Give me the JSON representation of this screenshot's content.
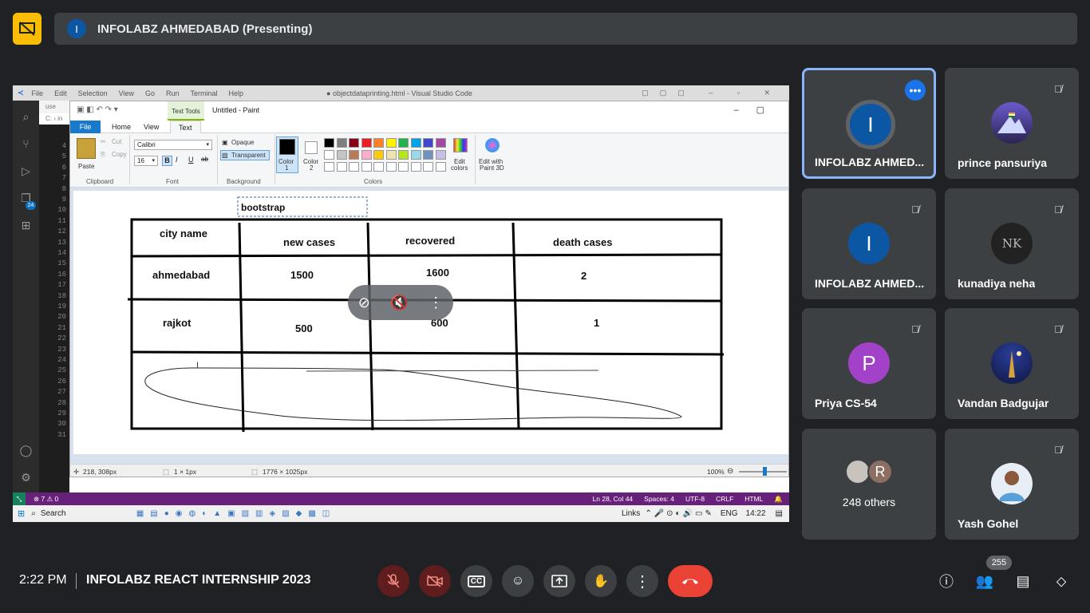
{
  "presenter_bar": {
    "avatar_letter": "I",
    "title": "INFOLABZ AHMEDABAD (Presenting)"
  },
  "vscode": {
    "menu": [
      "File",
      "Edit",
      "Selection",
      "View",
      "Go",
      "Run",
      "Terminal",
      "Help"
    ],
    "window_title": "● objectdataprinting.html - Visual Studio Code",
    "tab_fragment": "use",
    "path_fragment": "C: › in",
    "line_numbers": [
      "4",
      "5",
      "6",
      "7",
      "8",
      "9",
      "10",
      "11",
      "12",
      "13",
      "14",
      "15",
      "16",
      "17",
      "18",
      "19",
      "20",
      "21",
      "22",
      "23",
      "24",
      "25",
      "26",
      "27",
      "28",
      "29",
      "30",
      "31"
    ],
    "badge_count": "24",
    "status_left": "⊗ 7 ⚠ 0",
    "status_right": [
      "Ln 28, Col 44",
      "Spaces: 4",
      "UTF-8",
      "CRLF",
      "HTML"
    ]
  },
  "taskbar": {
    "search": "Search",
    "links": "Links",
    "lang": "ENG",
    "time": "14:22"
  },
  "paint": {
    "window_title": "Untitled - Paint",
    "tools_tab": "Text Tools",
    "tabs": [
      "File",
      "Home",
      "View",
      "Text"
    ],
    "paste": "Paste",
    "cut": "Cut",
    "copy": "Copy",
    "group_clipboard": "Clipboard",
    "font_name": "Calibri",
    "font_size": "16",
    "group_font": "Font",
    "opaque": "Opaque",
    "transparent": "Transparent",
    "group_background": "Background",
    "color1": "Color\n1",
    "color1_a": "Color",
    "color1_b": "1",
    "color2_a": "Color",
    "color2_b": "2",
    "edit_colors_a": "Edit",
    "edit_colors_b": "colors",
    "paint3d_a": "Edit with",
    "paint3d_b": "Paint 3D",
    "group_colors": "Colors",
    "palette": [
      "#000000",
      "#7f7f7f",
      "#880015",
      "#ed1c24",
      "#ff7f27",
      "#fff200",
      "#22b14c",
      "#00a2e8",
      "#3f48cc",
      "#a349a4",
      "#ffffff",
      "#c3c3c3",
      "#b97a57",
      "#ffaec9",
      "#ffc90e",
      "#efe4b0",
      "#b5e61d",
      "#99d9ea",
      "#7092be",
      "#c8bfe7"
    ],
    "status_pos": "218, 308px",
    "status_sel": "1 × 1px",
    "status_size": "1776 × 1025px",
    "zoom": "100%"
  },
  "drawing": {
    "text_box": "bootstrap",
    "headers": [
      "city name",
      "new cases",
      "recovered",
      "death cases"
    ],
    "rows": [
      [
        "ahmedabad",
        "1500",
        "1600",
        "2"
      ],
      [
        "rajkot",
        "500",
        "600",
        "1"
      ]
    ]
  },
  "participants": [
    {
      "name": "INFOLABZ AHMED...",
      "letter": "I",
      "color": "#0b57a4",
      "active": true
    },
    {
      "name": "prince pansuriya",
      "letter": "",
      "color": "#5b4a8a"
    },
    {
      "name": "INFOLABZ AHMED...",
      "letter": "I",
      "color": "#0b57a4"
    },
    {
      "name": "kunadiya neha",
      "letter": "NK",
      "color": "#222222"
    },
    {
      "name": "Priya CS-54",
      "letter": "P",
      "color": "#a142c9"
    },
    {
      "name": "Vandan Badgujar",
      "letter": "",
      "color": "#1b2a6b"
    },
    {
      "name": "248 others",
      "letter": "R",
      "color": "#8d6e63"
    },
    {
      "name": "Yash Gohel",
      "letter": "",
      "color": "#e8eef5"
    }
  ],
  "bottom": {
    "time": "2:22 PM",
    "meeting": "INFOLABZ REACT INTERNSHIP 2023",
    "people_count": "255"
  }
}
